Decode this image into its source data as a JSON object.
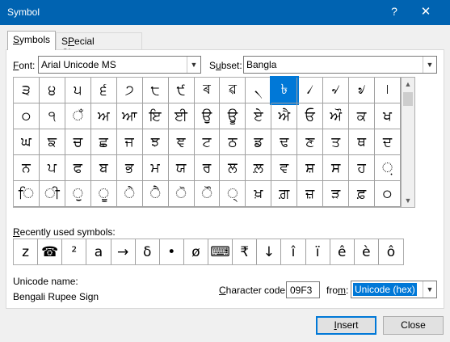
{
  "window": {
    "title": "Symbol",
    "help_glyph": "?",
    "close_glyph": "✕"
  },
  "tabs": {
    "symbols": {
      "label": "Symbols",
      "key": "S",
      "rest": "ymbols"
    },
    "special": {
      "label": "Special Characters",
      "key": "P",
      "pre": "S",
      "rest": "ecial Characters"
    }
  },
  "font": {
    "label": "Font:",
    "key": "F",
    "rest": "ont:",
    "value": "Arial Unicode MS"
  },
  "subset": {
    "label": "Subset:",
    "key": "u",
    "pre": "S",
    "rest": "bset:",
    "value": "Bangla"
  },
  "symbol_grid": [
    [
      "੩",
      "੪",
      "੫",
      "੬",
      "੭",
      "੮",
      "੯",
      "ৰ",
      "ৱ",
      "৲",
      "৳",
      "৴",
      "৵",
      "৶",
      "৷",
      "৸"
    ],
    [
      "੦",
      "੧",
      "ਁ",
      "ਅ",
      "ਆ",
      "ਇ",
      "ਈ",
      "ਉ",
      "ਊ",
      "ਏ",
      "ਐ",
      "ਓ",
      "ਔ",
      "ਕ",
      "ਖ",
      "ਗ"
    ],
    [
      "ਘ",
      "ਙ",
      "ਚ",
      "ਛ",
      "ਜ",
      "ਝ",
      "ਞ",
      "ਟ",
      "ਠ",
      "ਡ",
      "ਢ",
      "ਣ",
      "ਤ",
      "ਥ",
      "ਦ",
      "ਧ"
    ],
    [
      "ਨ",
      "ਪ",
      "ਫ",
      "ਬ",
      "ਭ",
      "ਮ",
      "ਯ",
      "ਰ",
      "ਲ",
      "ਲ਼",
      "ਵ",
      "ਸ਼",
      "ਸ",
      "ਹ",
      "਼",
      "ਾ"
    ],
    [
      "ਿ",
      "ੀ",
      "ੁ",
      "ੂ",
      "ੇ",
      "ੈ",
      "ੋ",
      "ੌ",
      "੍",
      "ਖ਼",
      "ਗ਼",
      "ਜ਼",
      "ੜ",
      "ਫ਼",
      "੦",
      "੧"
    ]
  ],
  "selected_symbol": "৳",
  "recently_used": {
    "label": "Recently used symbols:",
    "key": "R",
    "rest": "ecently used symbols:",
    "symbols": [
      "z",
      "☎",
      "²",
      "a",
      "→",
      "δ",
      "•",
      "ø",
      "⌨",
      "₹",
      "↓",
      "î",
      "ï",
      "ê",
      "è",
      "ô"
    ]
  },
  "unicode_name": {
    "label": "Unicode name:",
    "value": "Bengali Rupee Sign"
  },
  "character_code": {
    "label": "Character code:",
    "key": "C",
    "rest": "haracter code:",
    "value": "09F3"
  },
  "from": {
    "label": "from:",
    "key": "m",
    "pre": "fro",
    "rest": ":",
    "value": "Unicode (hex)"
  },
  "buttons": {
    "insert": "Insert",
    "insert_key": "I",
    "insert_rest": "nsert",
    "close": "Close"
  },
  "colors": {
    "titlebar": "#0063b1",
    "selection": "#0078d7"
  }
}
